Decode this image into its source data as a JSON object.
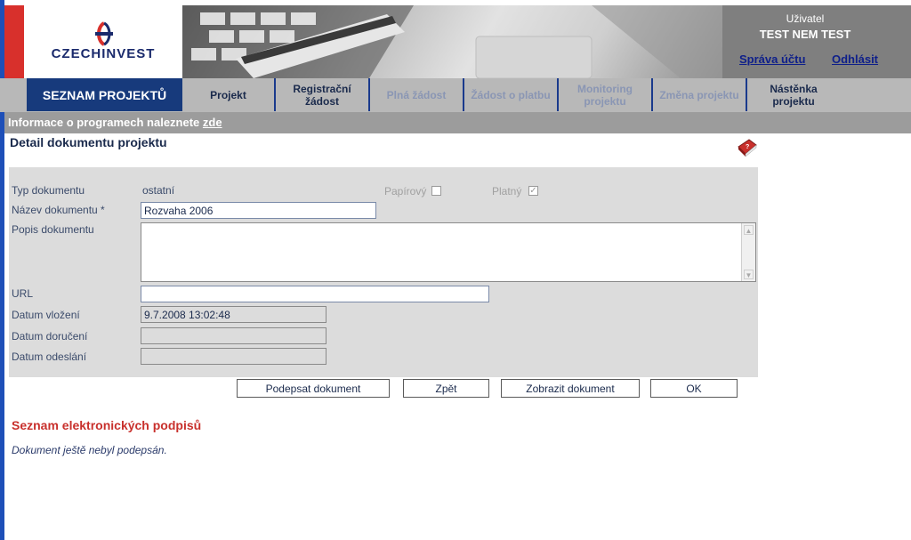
{
  "logo": {
    "text": "CZECHINVEST"
  },
  "user": {
    "label": "Uživatel",
    "name": "TEST NEM TEST",
    "account_link": "Správa účtu",
    "logout_link": "Odhlásit"
  },
  "nav": {
    "active": "SEZNAM PROJEKTŮ",
    "tabs": [
      {
        "label": "Projekt",
        "enabled": true
      },
      {
        "label": "Registrační žádost",
        "enabled": true
      },
      {
        "label": "Plná žádost",
        "enabled": false
      },
      {
        "label": "Žádost o platbu",
        "enabled": false
      },
      {
        "label": "Monitoring projektu",
        "enabled": false
      },
      {
        "label": "Změna projektu",
        "enabled": false
      },
      {
        "label": "Nástěnka projektu",
        "enabled": true
      }
    ]
  },
  "info": {
    "text": "Informace o programech naleznete ",
    "link": "zde"
  },
  "page": {
    "title": "Detail dokumentu projektu"
  },
  "form": {
    "type_label": "Typ dokumentu",
    "type_value": "ostatní",
    "paper_label": "Papírový",
    "paper_checked": false,
    "valid_label": "Platný",
    "valid_checked": true,
    "name_label": "Název dokumentu *",
    "name_value": "Rozvaha 2006",
    "description_label": "Popis dokumentu",
    "description_value": "",
    "url_label": "URL",
    "url_value": "",
    "inserted_label": "Datum vložení",
    "inserted_value": "9.7.2008 13:02:48",
    "delivered_label": "Datum doručení",
    "delivered_value": "",
    "sent_label": "Datum odeslání",
    "sent_value": ""
  },
  "buttons": {
    "sign": "Podepsat dokument",
    "back": "Zpět",
    "show": "Zobrazit dokument",
    "ok": "OK"
  },
  "signatures": {
    "title": "Seznam elektronických podpisů",
    "empty_note": "Dokument ještě nebyl podepsán."
  },
  "colors": {
    "nav_active": "#173a7c",
    "accent_red": "#d8302c",
    "signature_title": "#c8302c"
  }
}
